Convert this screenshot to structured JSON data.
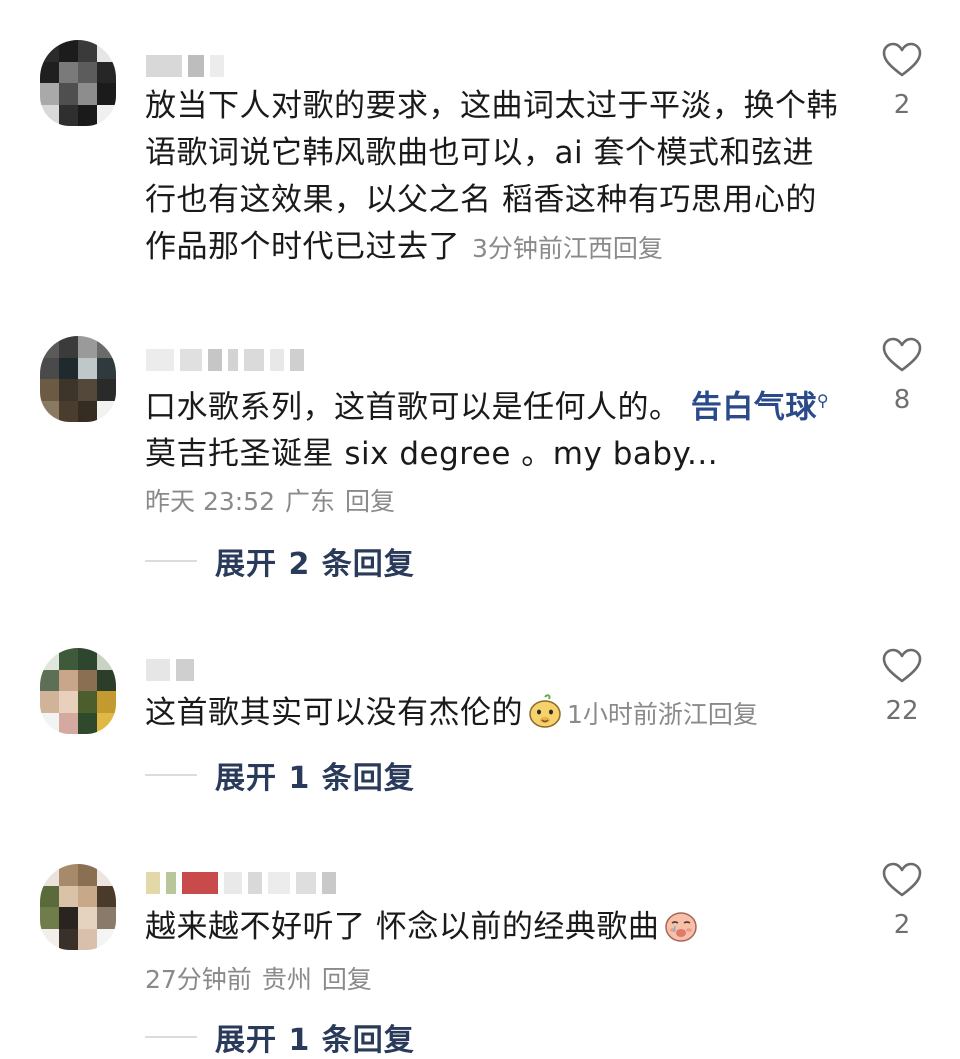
{
  "comments": [
    {
      "text": "放当下人对歌的要求，这曲词太过于平淡，换个韩语歌词说它韩风歌曲也可以，ai 套个模式和弦进行也有这效果，以父之名 稻香这种有巧思用心的作品那个时代已过去了",
      "time": "3分钟前",
      "location": "江西",
      "reply_label": "回复",
      "likes": "2"
    },
    {
      "text_line1": "口水歌系列，这首歌可以是任何人的。",
      "tag": "告白气球",
      "text_line2": "莫吉托圣诞星 six degree 。my baby...",
      "time": "昨天 23:52",
      "location": "广东",
      "reply_label": "回复",
      "likes": "8",
      "expand_label": "展开 2 条回复"
    },
    {
      "text": "这首歌其实可以没有杰伦的",
      "emoji": "smug-face-emoji",
      "time": "1小时前",
      "location": "浙江",
      "reply_label": "回复",
      "likes": "22",
      "expand_label": "展开 1 条回复"
    },
    {
      "text": "越来越不好听了 怀念以前的经典歌曲",
      "emoji": "crying-face-emoji",
      "time": "27分钟前",
      "location": "贵州",
      "reply_label": "回复",
      "likes": "2",
      "expand_label": "展开 1 条回复"
    }
  ],
  "icons": {
    "like": "heart-outline-icon",
    "search_tag": "search-mark-icon"
  },
  "colors": {
    "text": "#1a1a1a",
    "meta": "#8a8a8a",
    "link": "#2a4a8a",
    "expand": "#2a3a5a"
  }
}
